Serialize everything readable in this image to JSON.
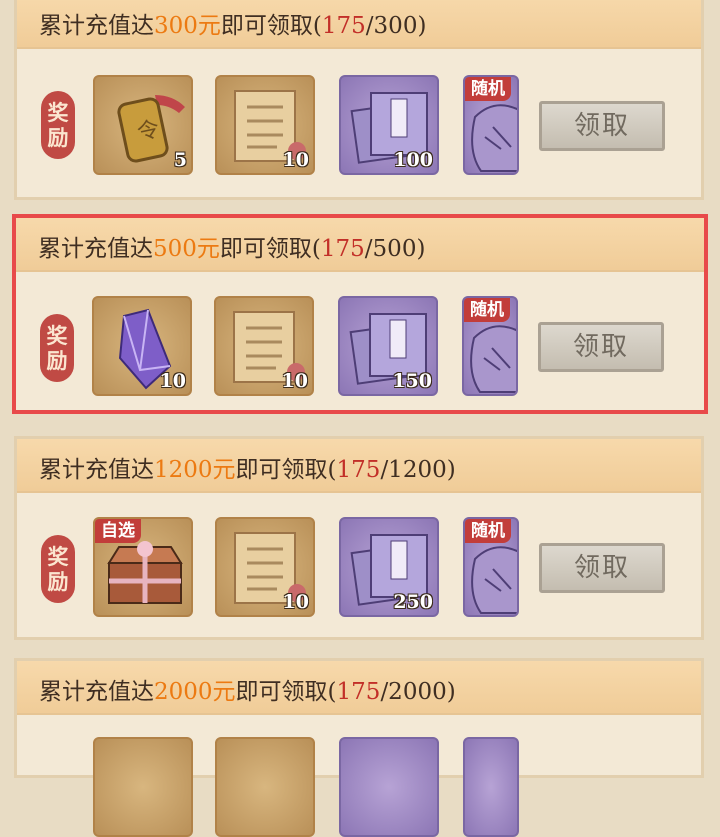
{
  "tiers": [
    {
      "prefix": "累计充值达",
      "amount": "300元",
      "suffix": "即可领取(",
      "current": "175",
      "target": "/300)",
      "reward_tag": [
        "奖",
        "励"
      ],
      "items": [
        {
          "icon": "token-icon",
          "qty": "5"
        },
        {
          "icon": "scroll-icon",
          "qty": "10"
        },
        {
          "icon": "book-icon",
          "qty": "100"
        },
        {
          "icon": "bag-icon",
          "badge": "随机"
        }
      ],
      "button": "领取"
    },
    {
      "prefix": "累计充值达",
      "amount": "500元",
      "suffix": "即可领取(",
      "current": "175",
      "target": "/500)",
      "reward_tag": [
        "奖",
        "励"
      ],
      "items": [
        {
          "icon": "crystal-icon",
          "qty": "10"
        },
        {
          "icon": "scroll-icon",
          "qty": "10"
        },
        {
          "icon": "book-icon",
          "qty": "150"
        },
        {
          "icon": "bag-icon",
          "badge": "随机"
        }
      ],
      "button": "领取"
    },
    {
      "prefix": "累计充值达",
      "amount": "1200元",
      "suffix": "即可领取(",
      "current": "175",
      "target": "/1200)",
      "reward_tag": [
        "奖",
        "励"
      ],
      "items": [
        {
          "icon": "chest-icon",
          "badge": "自选"
        },
        {
          "icon": "scroll-icon",
          "qty": "10"
        },
        {
          "icon": "book-icon",
          "qty": "250"
        },
        {
          "icon": "bag-icon",
          "badge": "随机"
        }
      ],
      "button": "领取"
    },
    {
      "prefix": "累计充值达",
      "amount": "2000元",
      "suffix": "即可领取(",
      "current": "175",
      "target": "/2000)"
    }
  ],
  "colors": {
    "amount": "#ec7a12",
    "current": "#c22f28",
    "highlight_border": "#e84a4a",
    "tag_bg": "#c04a44"
  }
}
